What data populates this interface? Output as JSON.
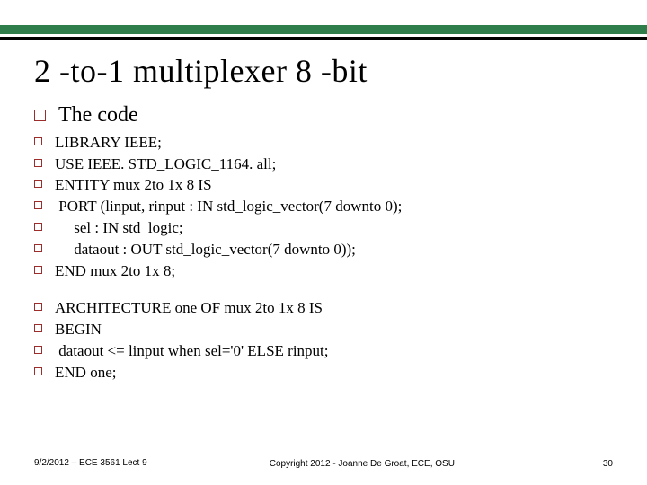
{
  "title": "2 -to-1 multiplexer 8 -bit",
  "heading": "The code",
  "lines1": [
    "LIBRARY IEEE;",
    "USE IEEE. STD_LOGIC_1164. all;",
    "ENTITY mux 2to 1x 8 IS",
    " PORT (linput, rinput : IN std_logic_vector(7 downto 0);",
    "     sel : IN std_logic;",
    "     dataout : OUT std_logic_vector(7 downto 0));",
    "END mux 2to 1x 8;"
  ],
  "lines2": [
    "ARCHITECTURE one OF mux 2to 1x 8 IS",
    "BEGIN",
    " dataout <= linput when sel='0' ELSE rinput;",
    "END one;"
  ],
  "footer": {
    "left": "9/2/2012 – ECE 3561 Lect 9",
    "center": "Copyright 2012 - Joanne De Groat, ECE, OSU",
    "right": "30"
  }
}
